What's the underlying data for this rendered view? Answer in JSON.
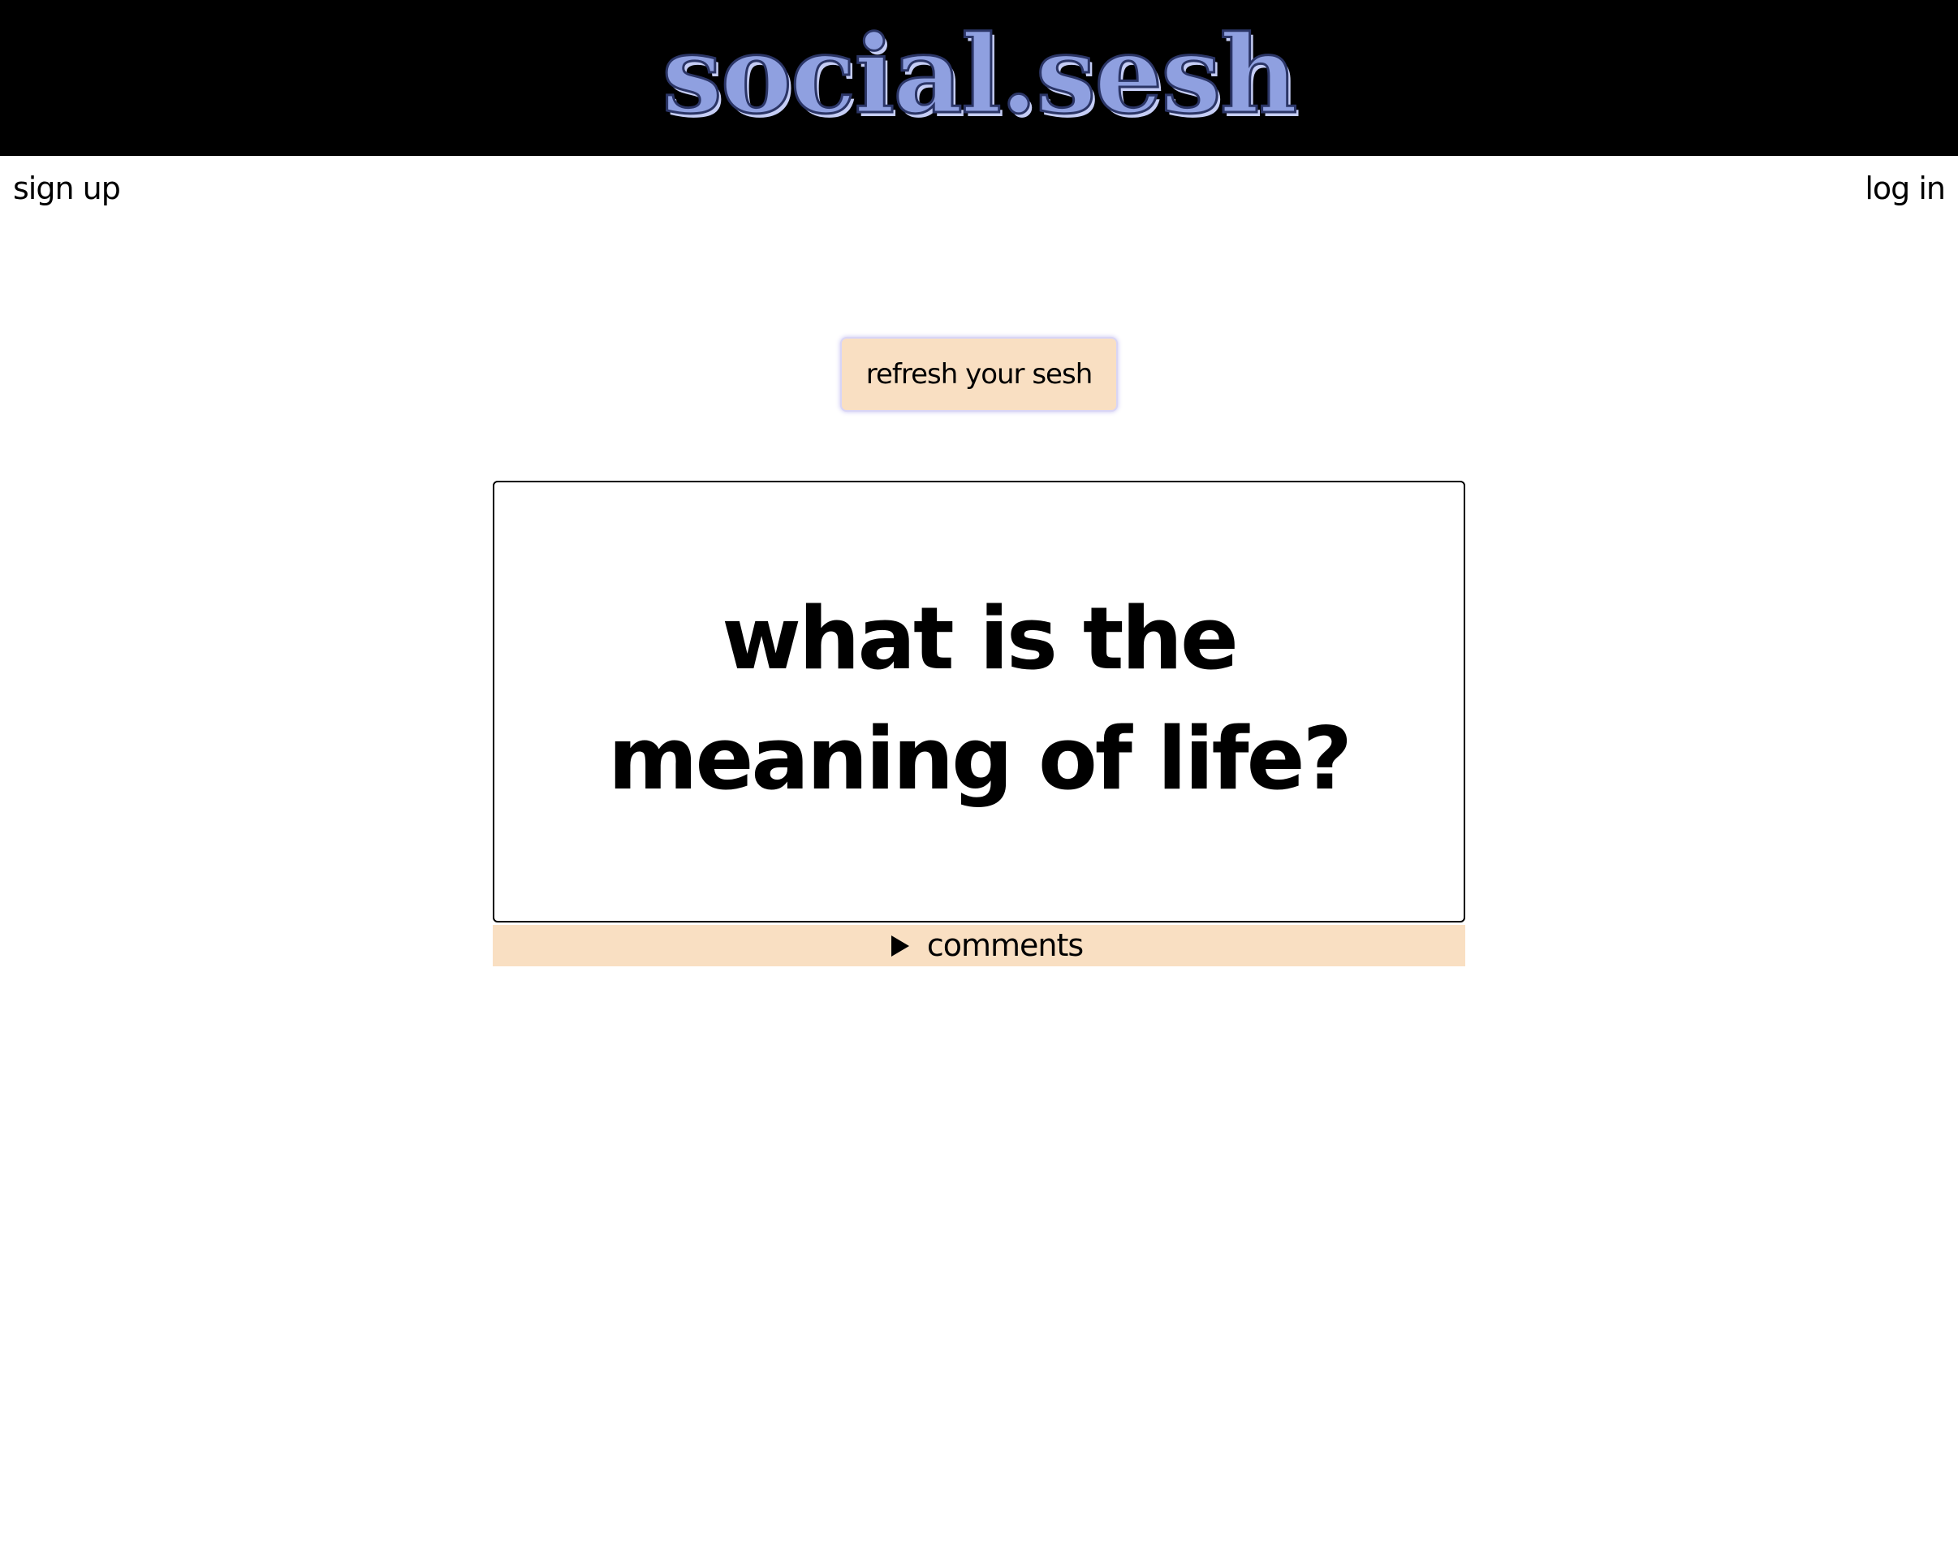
{
  "header": {
    "logo_text": "social.sesh"
  },
  "nav": {
    "signup_label": "sign up",
    "login_label": "log in"
  },
  "main": {
    "refresh_label": "refresh your sesh",
    "question": "what is the meaning of life?",
    "comments_label": "comments"
  },
  "icons": {
    "comments_toggle": "triangle-right-icon"
  },
  "colors": {
    "header_bg": "#000000",
    "logo_fill": "#8fa0e0",
    "accent_peach": "#f9dfc2",
    "button_border": "#d9d5f5"
  }
}
